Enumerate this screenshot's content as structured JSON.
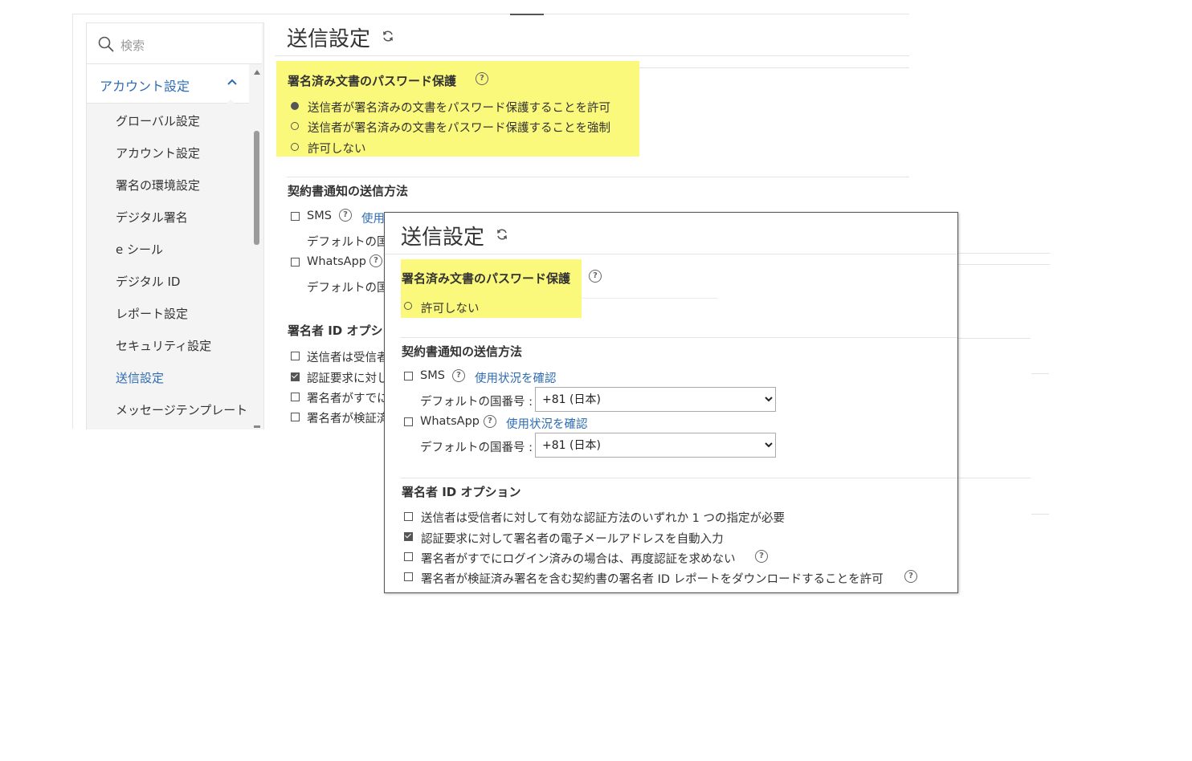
{
  "sidebar": {
    "search_placeholder": "検索",
    "section_label": "アカウント設定",
    "items": [
      {
        "label": "グローバル設定"
      },
      {
        "label": "アカウント設定"
      },
      {
        "label": "署名の環境設定"
      },
      {
        "label": "デジタル署名"
      },
      {
        "label": "e シール"
      },
      {
        "label": "デジタル ID"
      },
      {
        "label": "レポート設定"
      },
      {
        "label": "セキュリティ設定"
      },
      {
        "label": "送信設定"
      },
      {
        "label": "メッセージテンプレート"
      }
    ],
    "active_index": 8
  },
  "main": {
    "title": "送信設定",
    "password": {
      "heading": "署名済み文書のパスワード保護",
      "options": [
        "送信者が署名済みの文書をパスワード保護することを許可",
        "送信者が署名済みの文書をパスワード保護することを強制",
        "許可しない"
      ],
      "selected": 0
    },
    "notify": {
      "heading": "契約書通知の送信方法",
      "sms": "SMS",
      "sms_link_partial": "使用",
      "default_country_partial": "デフォルトの国",
      "whatsapp": "WhatsApp"
    },
    "signer": {
      "heading_partial": "署名者 ID オプシ",
      "items_partial": [
        "送信者は受信者",
        "認証要求に対し",
        "署名者がすでに",
        "署名者が検証済"
      ]
    }
  },
  "overlay": {
    "title": "送信設定",
    "password": {
      "heading": "署名済み文書のパスワード保護",
      "option": "許可しない"
    },
    "notify": {
      "heading": "契約書通知の送信方法",
      "sms": "SMS",
      "whatsapp": "WhatsApp",
      "usage_link": "使用状況を確認",
      "default_country_label": "デフォルトの国番号 :",
      "country_value": "+81 (日本)"
    },
    "signer": {
      "heading": "署名者 ID オプション",
      "items": [
        "送信者は受信者に対して有効な認証方法のいずれか 1 つの指定が必要",
        "認証要求に対して署名者の電子メールアドレスを自動入力",
        "署名者がすでにログイン済みの場合は、再度認証を求めない",
        "署名者が検証済み署名を含む契約書の署名者 ID レポートをダウンロードすることを許可"
      ],
      "checked": [
        false,
        true,
        false,
        false
      ]
    }
  },
  "colors": {
    "highlight": "#fbf97c",
    "link": "#2d6cb3"
  }
}
